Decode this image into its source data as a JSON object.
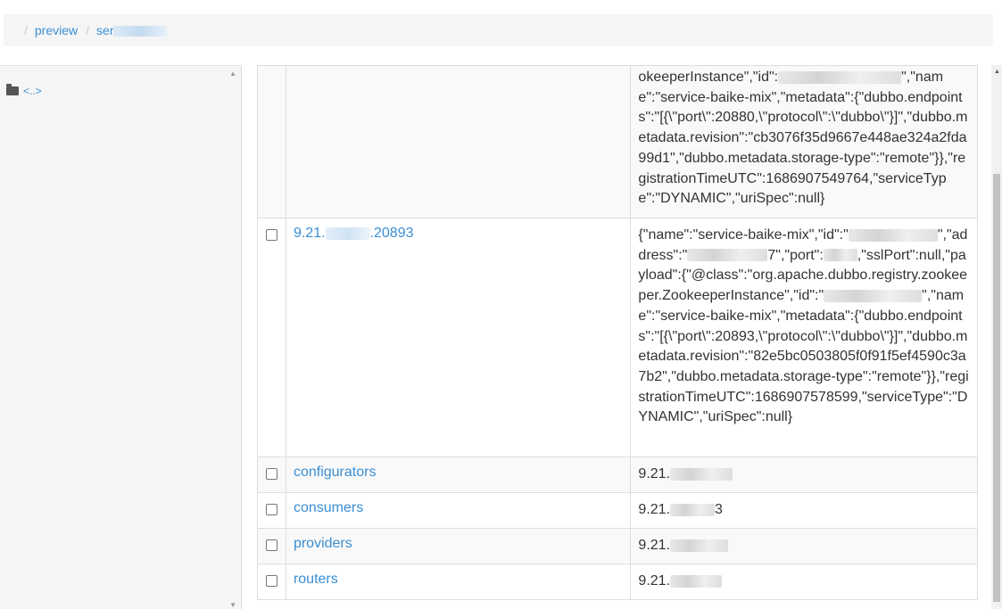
{
  "breadcrumb": {
    "sep1": "/",
    "item1": "preview",
    "sep2": "/",
    "item2": "ser"
  },
  "sidebar": {
    "parent_label": "<..>"
  },
  "table": {
    "row0": {
      "value": "okeeperInstance\",\"id\":",
      "value2": "\",\"name\":\"service-baike-mix\",\"metadata\":{\"dubbo.endpoints\":\"[{\\\"port\\\":20880,\\\"protocol\\\":\\\"dubbo\\\"}]\",\"dubbo.metadata.revision\":\"cb3076f35d9667e448ae324a2fda99d1\",\"dubbo.metadata.storage-type\":\"remote\"}},\"registrationTimeUTC\":1686907549764,\"serviceType\":\"DYNAMIC\",\"uriSpec\":null}"
    },
    "row1": {
      "name_prefix": "9.21.",
      "name_suffix": ".20893",
      "v1": "{\"name\":\"service-baike-mix\",\"id\":\"",
      "v2": "\",\"address\":\"",
      "v3": "7\",\"port\":",
      "v4": ",\"sslPort\":null,\"payload\":{\"@class\":\"org.apache.dubbo.registry.zookeeper.ZookeeperInstance\",\"id\":\"",
      "v5": "\",\"name\":\"service-baike-mix\",\"metadata\":{\"dubbo.endpoints\":\"[{\\\"port\\\":20893,\\\"protocol\\\":\\\"dubbo\\\"}]\",\"dubbo.metadata.revision\":\"82e5bc0503805f0f91f5ef4590c3a7b2\",\"dubbo.metadata.storage-type\":\"remote\"}},\"registrationTimeUTC\":1686907578599,\"serviceType\":\"DYNAMIC\",\"uriSpec\":null}"
    },
    "rows": [
      {
        "name": "configurators",
        "value": "9.21."
      },
      {
        "name": "consumers",
        "value": "9.21.",
        "value_tail": "3"
      },
      {
        "name": "providers",
        "value": "9.21."
      },
      {
        "name": "routers",
        "value": "9.21."
      }
    ]
  },
  "colors": {
    "link": "#3a8fd4",
    "stripe": "#f9f9f9",
    "border": "#dddddd"
  }
}
